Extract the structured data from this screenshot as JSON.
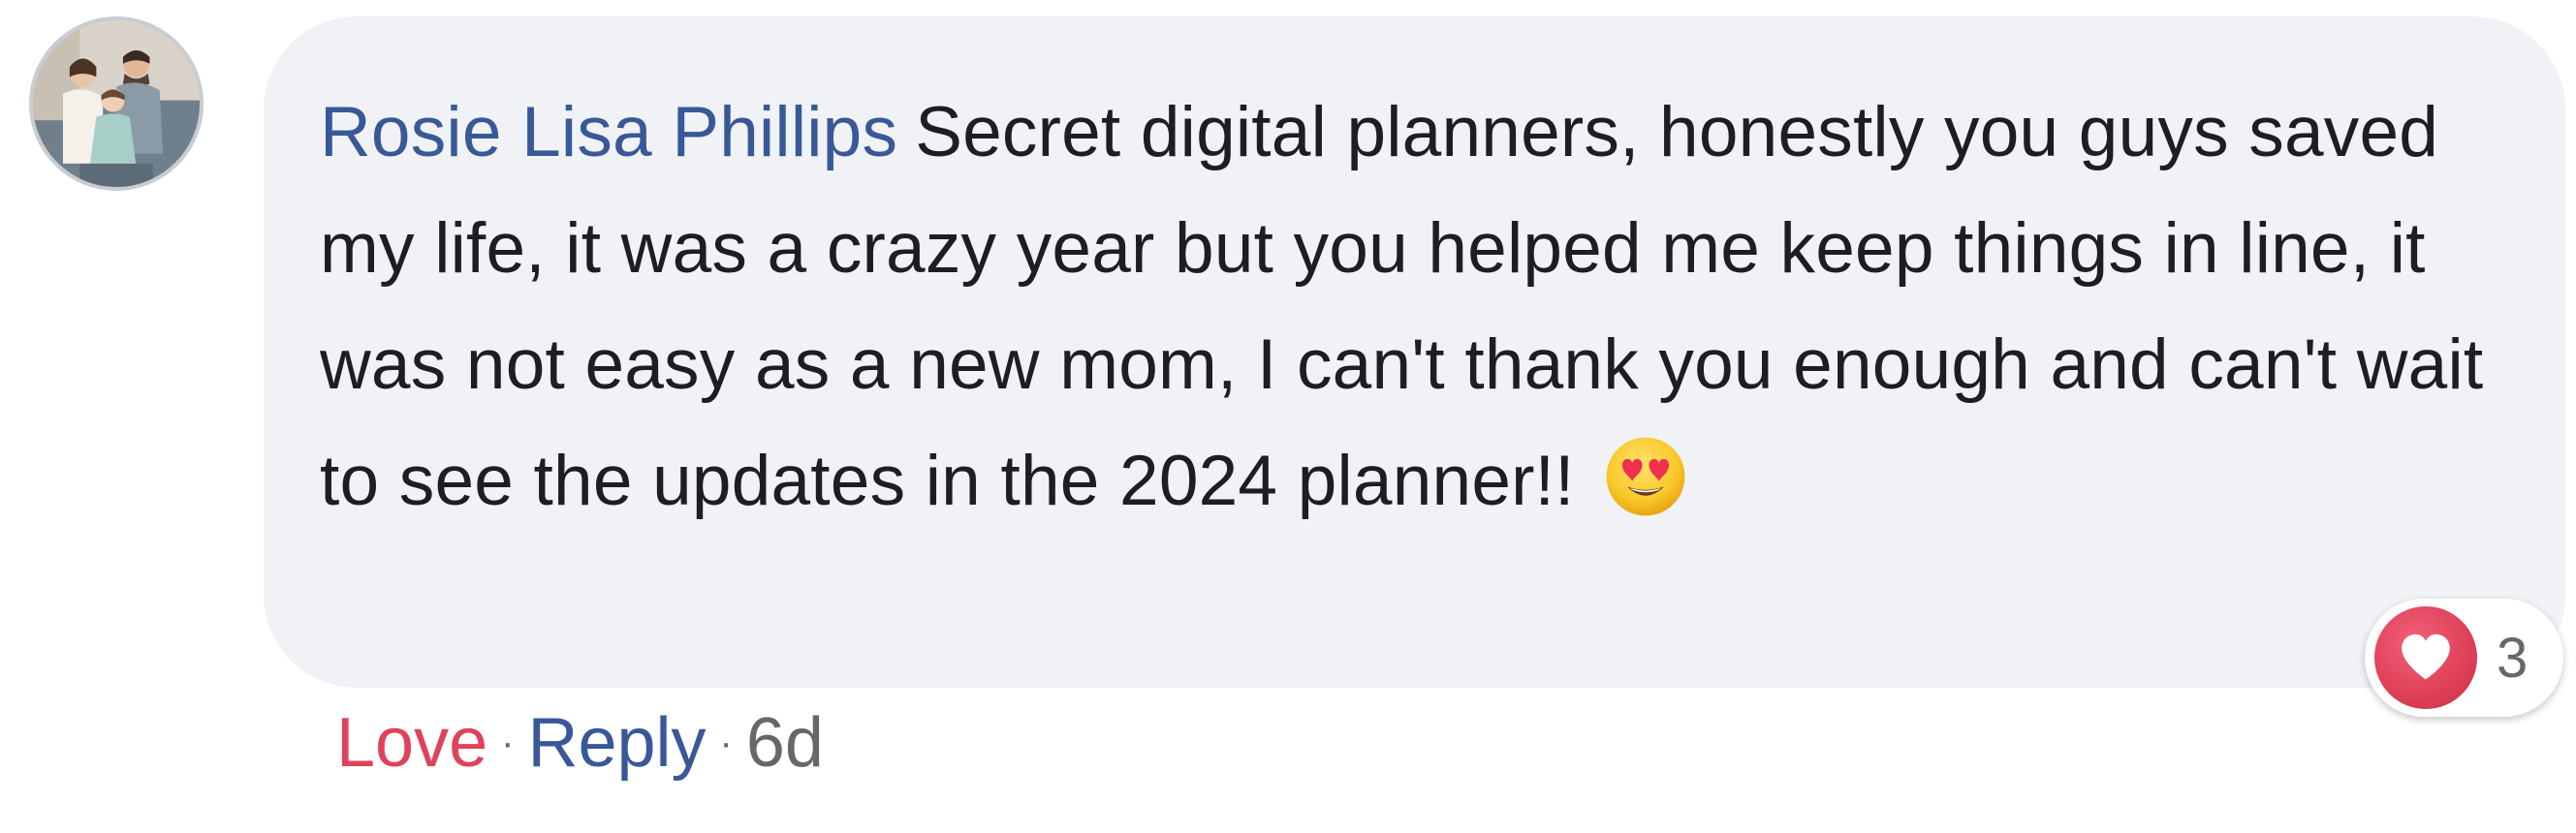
{
  "comment": {
    "author": "Rosie Lisa Phillips",
    "text": "Secret digital planners, honestly you guys saved my life, it was a crazy year but you helped me keep things in line, it was not easy as a new mom, I can't thank you enough and can't wait to see the updates in the 2024 planner!!",
    "emoji": "heart-eyes-emoji",
    "reaction": {
      "type": "love",
      "icon": "heart-icon",
      "count": "3",
      "color": "#e0425a"
    }
  },
  "actions": {
    "love_label": "Love",
    "separator": "·",
    "reply_label": "Reply",
    "timestamp": "6d"
  },
  "colors": {
    "author": "#385898",
    "love": "#e0425a",
    "bubble": "#f0f2f5",
    "meta": "#65676b",
    "text": "#1c1e21"
  }
}
